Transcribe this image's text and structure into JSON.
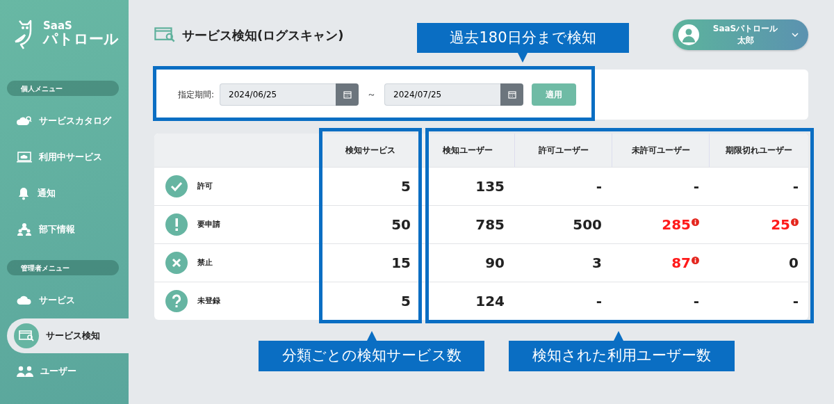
{
  "sidebar": {
    "logo": {
      "line1": "SaaS",
      "line2": "パトロール"
    },
    "sections": [
      {
        "heading": "個人メニュー",
        "items": [
          {
            "label": "サービスカタログ",
            "kind": "cloud-search",
            "selected": false
          },
          {
            "label": "利用中サービス",
            "kind": "monitor",
            "selected": false
          },
          {
            "label": "通知",
            "kind": "bell",
            "selected": false
          },
          {
            "label": "部下情報",
            "kind": "team",
            "selected": false
          }
        ]
      },
      {
        "heading": "管理者メニュー",
        "items": [
          {
            "label": "サービス",
            "kind": "cloud",
            "selected": false
          },
          {
            "label": "サービス検知",
            "kind": "scan",
            "selected": true
          },
          {
            "label": "ユーザー",
            "kind": "users",
            "selected": false
          }
        ]
      }
    ]
  },
  "header": {
    "title": "サービス検知(ログスキャン)",
    "user": {
      "company": "SaaSパトロール",
      "name": "太郎"
    }
  },
  "filter": {
    "label": "指定期間:",
    "from": "2024/06/25",
    "separator": "～",
    "to": "2024/07/25",
    "apply": "適用"
  },
  "table": {
    "columns": [
      "検知サービス",
      "検知ユーザー",
      "許可ユーザー",
      "未許可ユーザー",
      "期限切れユーザー"
    ],
    "rows": [
      {
        "kind": "check",
        "label": "許可",
        "cells": [
          {
            "value": "5",
            "alert": false
          },
          {
            "value": "135",
            "alert": false
          },
          {
            "value": "-",
            "alert": false
          },
          {
            "value": "-",
            "alert": false
          },
          {
            "value": "-",
            "alert": false
          }
        ]
      },
      {
        "kind": "exclaim",
        "label": "要申請",
        "cells": [
          {
            "value": "50",
            "alert": false
          },
          {
            "value": "785",
            "alert": false
          },
          {
            "value": "500",
            "alert": false
          },
          {
            "value": "285",
            "alert": true
          },
          {
            "value": "25",
            "alert": true
          }
        ]
      },
      {
        "kind": "cross",
        "label": "禁止",
        "cells": [
          {
            "value": "15",
            "alert": false
          },
          {
            "value": "90",
            "alert": false
          },
          {
            "value": "3",
            "alert": false
          },
          {
            "value": "87",
            "alert": true
          },
          {
            "value": "0",
            "alert": false
          }
        ]
      },
      {
        "kind": "question",
        "label": "未登録",
        "cells": [
          {
            "value": "5",
            "alert": false
          },
          {
            "value": "124",
            "alert": false
          },
          {
            "value": "-",
            "alert": false
          },
          {
            "value": "-",
            "alert": false
          },
          {
            "value": "-",
            "alert": false
          }
        ]
      }
    ]
  },
  "annotations": [
    {
      "text": "過去180日分まで検知"
    },
    {
      "text": "分類ごとの検知サービス数"
    },
    {
      "text": "検知された利用ユーザー数"
    }
  ]
}
